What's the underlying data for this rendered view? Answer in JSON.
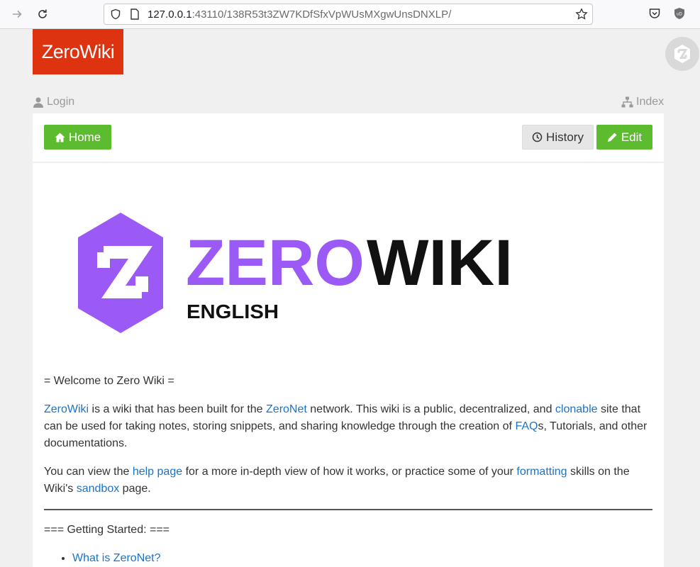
{
  "browser": {
    "url_host": "127.0.0.1",
    "url_rest": ":43110/138R53t3ZW7KDfSfxVpWUsMXgwUnsDNXLP/",
    "ublock_badge": "uD"
  },
  "site": {
    "logo_text": "ZeroWiki",
    "login_label": "Login",
    "index_label": "Index"
  },
  "toolbar": {
    "home_label": "Home",
    "history_label": "History",
    "edit_label": "Edit"
  },
  "hero": {
    "word_zero": "ZERO",
    "word_wiki": "WIKI",
    "subtitle": "ENGLISH"
  },
  "article": {
    "heading": "= Welcome to Zero Wiki =",
    "p1": {
      "link_zerowiki": "ZeroWiki",
      "t1": " is a wiki that has been built for the ",
      "link_zeronet": "ZeroNet",
      "t2": " network. This wiki is a public, decentralized, and ",
      "link_clonable": "clonable",
      "t3": " site that can be used for taking notes, storing snippets, and sharing knowledge through the creation of ",
      "link_faq": "FAQ",
      "t4": "s, Tutorials, and other documentations."
    },
    "p2": {
      "t1": "You can view the ",
      "link_help": "help page",
      "t2": " for a more in-depth view of how it works, or practice some of your ",
      "link_formatting": "formatting",
      "t3": " skills on the Wiki's ",
      "link_sandbox": "sandbox",
      "t4": " page."
    },
    "section_heading": "=== Getting Started: ===",
    "list": [
      "What is ZeroNet?"
    ]
  },
  "colors": {
    "logo_red": "#dd3311",
    "button_green": "#5cbb2e",
    "hero_purple": "#9b59f5",
    "link_blue": "#1a73c9"
  }
}
